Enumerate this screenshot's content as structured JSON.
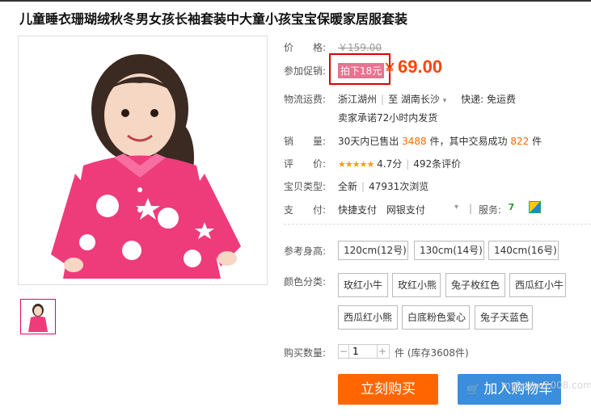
{
  "product": {
    "title": "儿童睡衣珊瑚绒秋冬男女孩长袖套装中大童小孩宝宝保暖家居服套装"
  },
  "price": {
    "label": "价　　格:",
    "original": "￥159.00"
  },
  "promo": {
    "label": "参加促销:",
    "tag": "拍下18元",
    "currency": "￥",
    "price": "69.00"
  },
  "shipping": {
    "label": "物流运费:",
    "from": "浙江湖州",
    "to_prefix": "至",
    "to": "湖南长沙",
    "fee": "快递: 免运费",
    "promise": "卖家承诺72小时内发货"
  },
  "sales": {
    "label": "销　　量:",
    "prefix": "30天内已售出",
    "sold": "3488",
    "middle": "件，其中交易成功",
    "success": "822",
    "suffix": "件"
  },
  "rating": {
    "label": "评　　价:",
    "stars": "★★★★★",
    "score": "4.7分",
    "reviews": "492条评价"
  },
  "item_type": {
    "label": "宝贝类型:",
    "condition": "全新",
    "views": "47931次浏览"
  },
  "payment": {
    "label": "支　　付:",
    "method1": "快捷支付",
    "method2": "网银支付",
    "service_label": "服务:"
  },
  "sizes": {
    "label": "参考身高:",
    "options": [
      "120cm(12号)",
      "130cm(14号)",
      "140cm(16号)"
    ]
  },
  "colors": {
    "label": "颜色分类:",
    "options": [
      "玫红小牛",
      "玫红小熊",
      "兔子枚红色",
      "西瓜红小牛",
      "西瓜红小熊",
      "白底粉色爱心",
      "兔子天蓝色"
    ]
  },
  "quantity": {
    "label": "购买数量:",
    "value": "1",
    "stock": "件 (库存3608件)"
  },
  "buttons": {
    "buy_now": "立刻购买",
    "add_cart": "加入购物车"
  },
  "watermark": "myhome2008.com",
  "colors_theme": {
    "price_orange": "#ff4400",
    "buy_orange": "#ff6600",
    "cart_blue": "#3a8edc",
    "promo_border": "#dd0000"
  }
}
